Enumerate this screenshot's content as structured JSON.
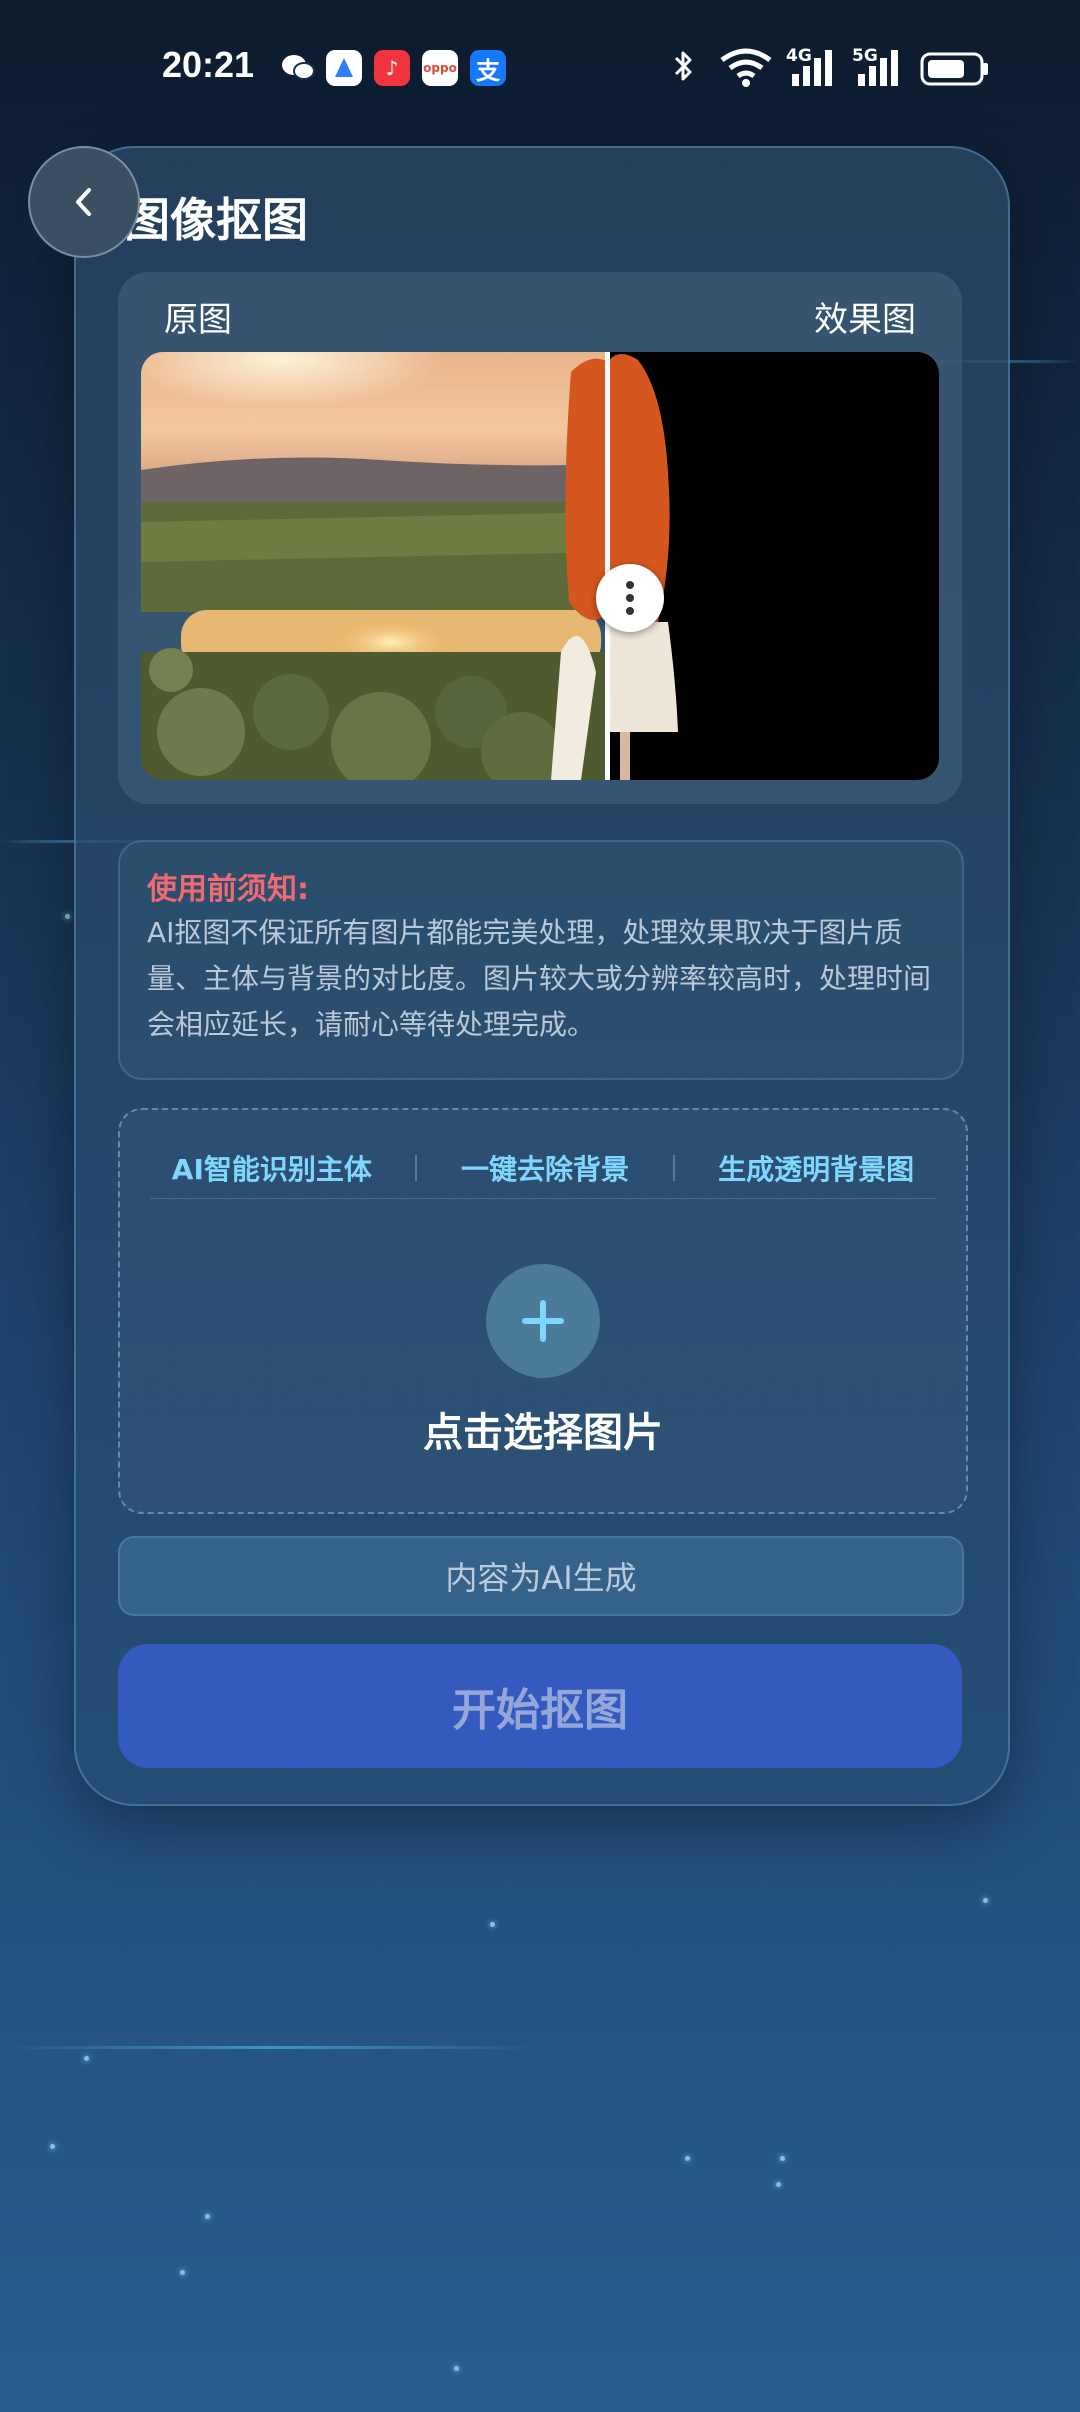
{
  "status_bar": {
    "time": "20:21",
    "network_4g": "4G",
    "network_5g": "5G",
    "notification_icons": [
      "wechat-icon",
      "browser-icon",
      "music-icon",
      "oppo-icon",
      "alipay-icon"
    ]
  },
  "header": {
    "title": "图像抠图"
  },
  "compare": {
    "original_label": "原图",
    "result_label": "效果图"
  },
  "notice": {
    "title": "使用前须知:",
    "body": "AI抠图不保证所有图片都能完美处理，处理效果取决于图片质量、主体与背景的对比度。图片较大或分辨率较高时，处理时间会相应延长，请耐心等待处理完成。"
  },
  "upload": {
    "features": [
      "AI智能识别主体",
      "一键去除背景",
      "生成透明背景图"
    ],
    "label": "点击选择图片"
  },
  "ai_notice": "内容为AI生成",
  "start_button": "开始抠图",
  "colors": {
    "accent": "#7fd6ff",
    "warning": "#ef6a72",
    "button": "#3459bf"
  }
}
